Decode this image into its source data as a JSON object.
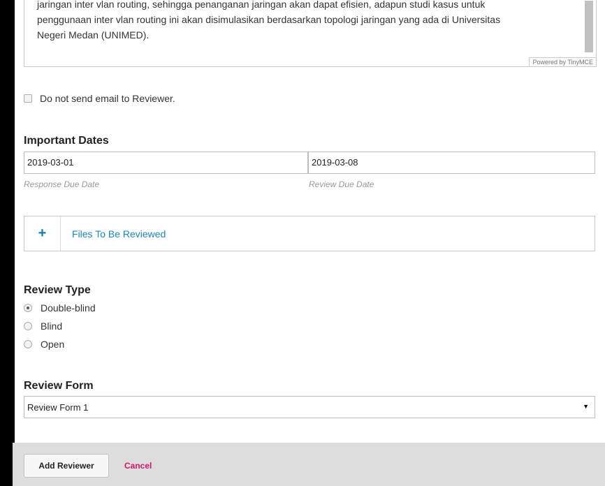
{
  "editor": {
    "line1": "jaringan inter vlan routing, sehingga penanganan jaringan akan dapat efisien, adapun studi kasus untuk",
    "line2": "penggunaan inter vlan routing ini akan disimulasikan berdasarkan topologi jaringan yang ada di Universitas",
    "line3": "Negeri Medan (UNIMED).",
    "powered_by": "Powered by TinyMCE"
  },
  "notify": {
    "label": "Do not send email to Reviewer.",
    "checked": false
  },
  "important_dates": {
    "title": "Important Dates",
    "response_due": {
      "value": "2019-03-01",
      "hint": "Response Due Date"
    },
    "review_due": {
      "value": "2019-03-08",
      "hint": "Review Due Date"
    }
  },
  "files": {
    "toggle": "+",
    "label": "Files To Be Reviewed"
  },
  "review_type": {
    "title": "Review Type",
    "options": [
      {
        "label": "Double-blind",
        "checked": true
      },
      {
        "label": "Blind",
        "checked": false
      },
      {
        "label": "Open",
        "checked": false
      }
    ]
  },
  "review_form": {
    "title": "Review Form",
    "selected": "Review Form 1",
    "caret": "▼"
  },
  "actions": {
    "add_label": "Add Reviewer",
    "cancel_label": "Cancel"
  }
}
